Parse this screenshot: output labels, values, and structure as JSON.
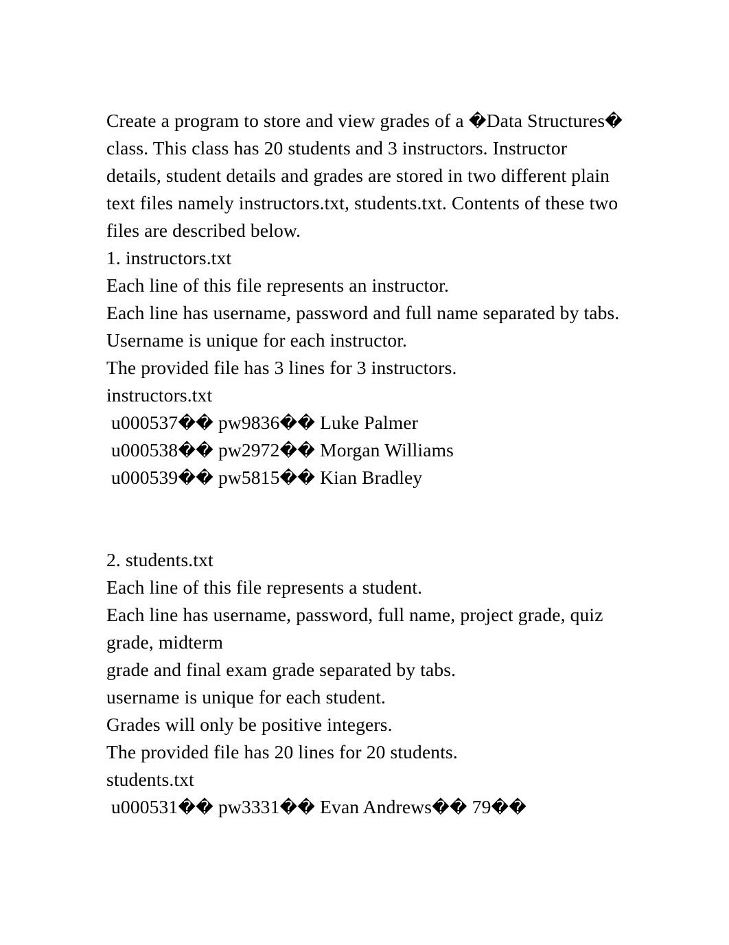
{
  "document": {
    "kind": "plain-text-assignment",
    "page_background": "#ffffff",
    "text_color": "#000000",
    "replacement_char": "�",
    "lines": [
      {
        "id": "intro-paragraph",
        "text": "Create a program to store and view grades of a �Data Structures� class. This class has 20 students and 3 instructors. Instructor details, student details and grades are stored in two different plain text files namely instructors.txt, students.txt. Contents of these two files are described below."
      },
      {
        "id": "section-1-heading",
        "text": "1. instructors.txt"
      },
      {
        "id": "instructors-line-meaning",
        "text": "Each line of this file represents an instructor."
      },
      {
        "id": "instructors-line-fields",
        "text": "Each line has username, password and full name separated by tabs."
      },
      {
        "id": "instructors-username-unique",
        "text": "Username is unique for each instructor."
      },
      {
        "id": "instructors-line-count",
        "text": "The provided file has 3 lines for 3 instructors."
      },
      {
        "id": "instructors-file-label",
        "text": "instructors.txt"
      },
      {
        "id": "instructor-record-1",
        "text": " u000537�� pw9836�� Luke Palmer"
      },
      {
        "id": "instructor-record-2",
        "text": " u000538�� pw2972�� Morgan Williams"
      },
      {
        "id": "instructor-record-3",
        "text": " u000539�� pw5815�� Kian Bradley"
      },
      {
        "id": "blank-1",
        "text": ""
      },
      {
        "id": "blank-2",
        "text": ""
      },
      {
        "id": "section-2-heading",
        "text": "2. students.txt"
      },
      {
        "id": "students-line-meaning",
        "text": "Each line of this file represents a student."
      },
      {
        "id": "students-line-fields",
        "text": "Each line has username, password, full name, project grade, quiz grade, midterm"
      },
      {
        "id": "students-line-fields-cont",
        "text": "grade and final exam grade separated by tabs."
      },
      {
        "id": "students-username-unique",
        "text": "username is unique for each student."
      },
      {
        "id": "students-grades-note",
        "text": "Grades will only be positive integers."
      },
      {
        "id": "students-line-count",
        "text": "The provided file has 20 lines for 20 students."
      },
      {
        "id": "students-file-label",
        "text": "students.txt"
      },
      {
        "id": "student-record-1",
        "text": " u000531�� pw3331�� Evan Andrews�� 79��"
      }
    ]
  }
}
